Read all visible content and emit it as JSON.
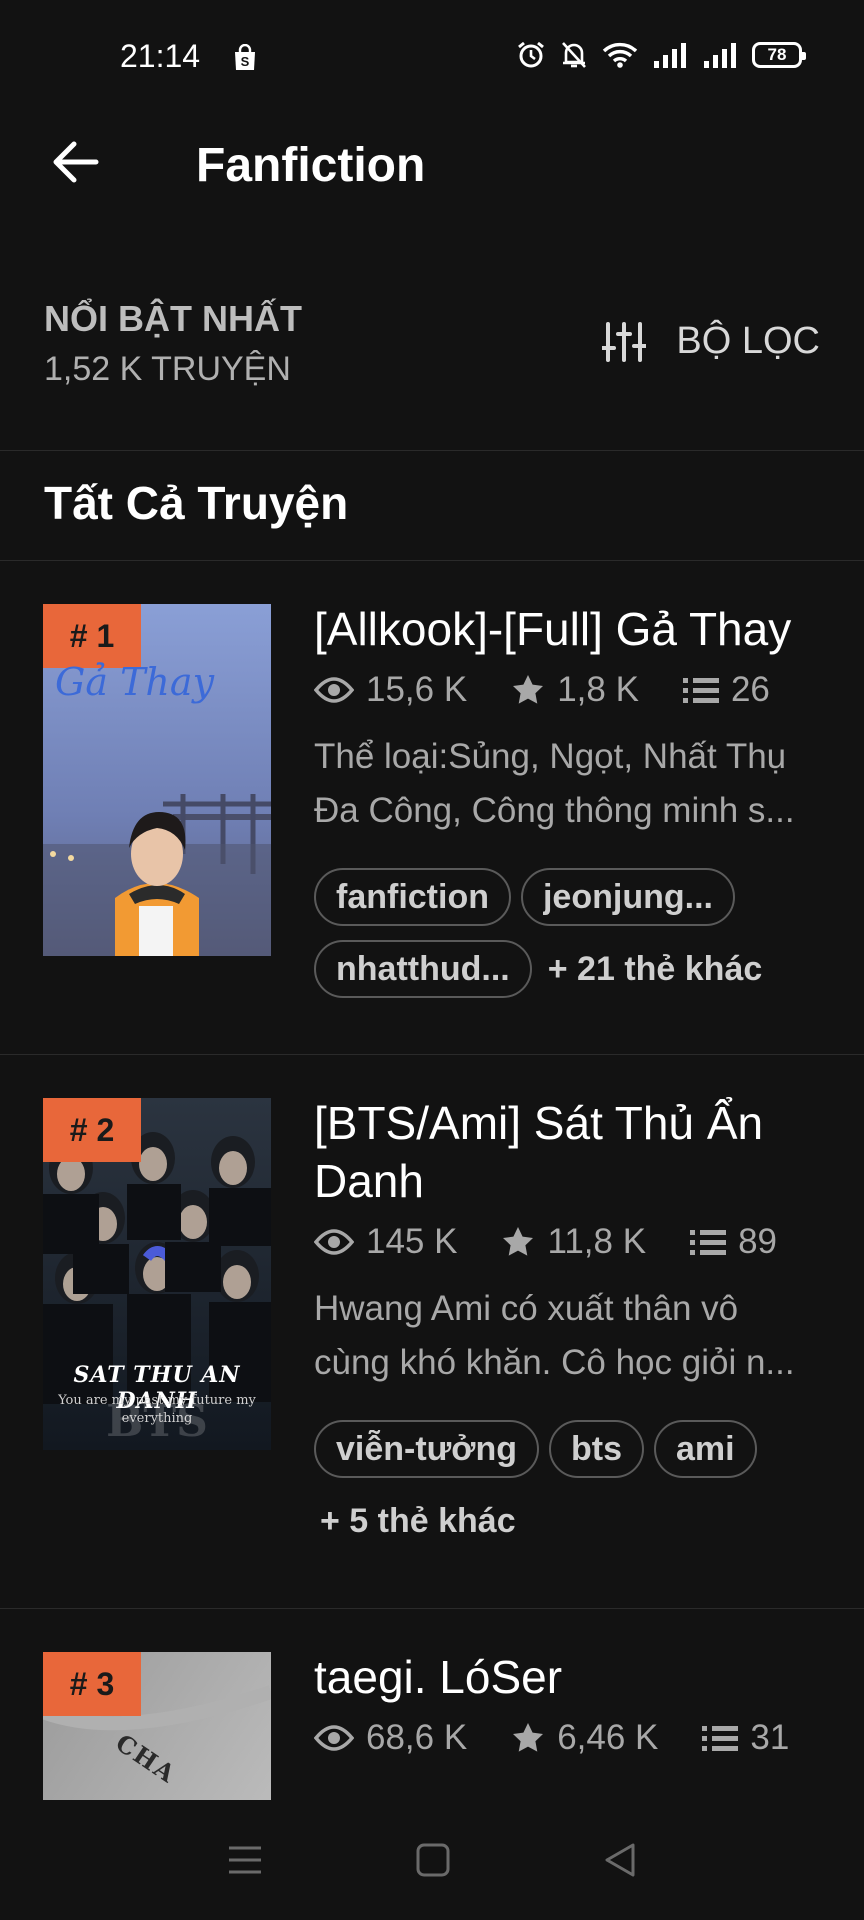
{
  "status_bar": {
    "time": "21:14",
    "battery": "78"
  },
  "header": {
    "title": "Fanfiction"
  },
  "sort": {
    "title": "NỔI BẬT NHẤT",
    "count": "1,52 K TRUYỆN",
    "filter_label": "BỘ LỌC"
  },
  "section": {
    "title": "Tất Cả Truyện"
  },
  "stories": [
    {
      "rank": "# 1",
      "cover_text": "Gả Thay",
      "title": "[Allkook]-[Full] Gả Thay",
      "reads": "15,6 K",
      "votes": "1,8 K",
      "parts": "26",
      "desc_line1": "Thể loại:Sủng, Ngọt, Nhất Thụ",
      "desc_line2": "Đa Công, Công thông minh s...",
      "tags": [
        "fanfiction",
        "jeonjung...",
        "nhatthud..."
      ],
      "more_tags": "+ 21 thẻ khác"
    },
    {
      "rank": "# 2",
      "cover_text": "SAT THU AN DANH",
      "cover_sub": "You are my past my future my everything",
      "cover_mark": "BTS",
      "title": "[BTS/Ami] Sát Thủ Ẩn Danh",
      "reads": "145 K",
      "votes": "11,8 K",
      "parts": "89",
      "desc_line1": "Hwang Ami có xuất thân vô",
      "desc_line2": "cùng khó khăn. Cô học giỏi n...",
      "tags": [
        "viễn-tưởng",
        "bts",
        "ami"
      ],
      "more_tags": "+ 5 thẻ khác"
    },
    {
      "rank": "# 3",
      "cover_text": "CHA",
      "title": "taegi. LóSer",
      "reads": "68,6 K",
      "votes": "6,46 K",
      "parts": "31"
    }
  ],
  "colors": {
    "background": "#121212",
    "rank_badge": "#e8673a",
    "muted_text": "#a8a8a8"
  },
  "icons": [
    "back-arrow-icon",
    "filter-sliders-icon",
    "eye-icon",
    "star-icon",
    "list-icon",
    "menu-icon",
    "home-icon",
    "back-triangle-icon"
  ]
}
